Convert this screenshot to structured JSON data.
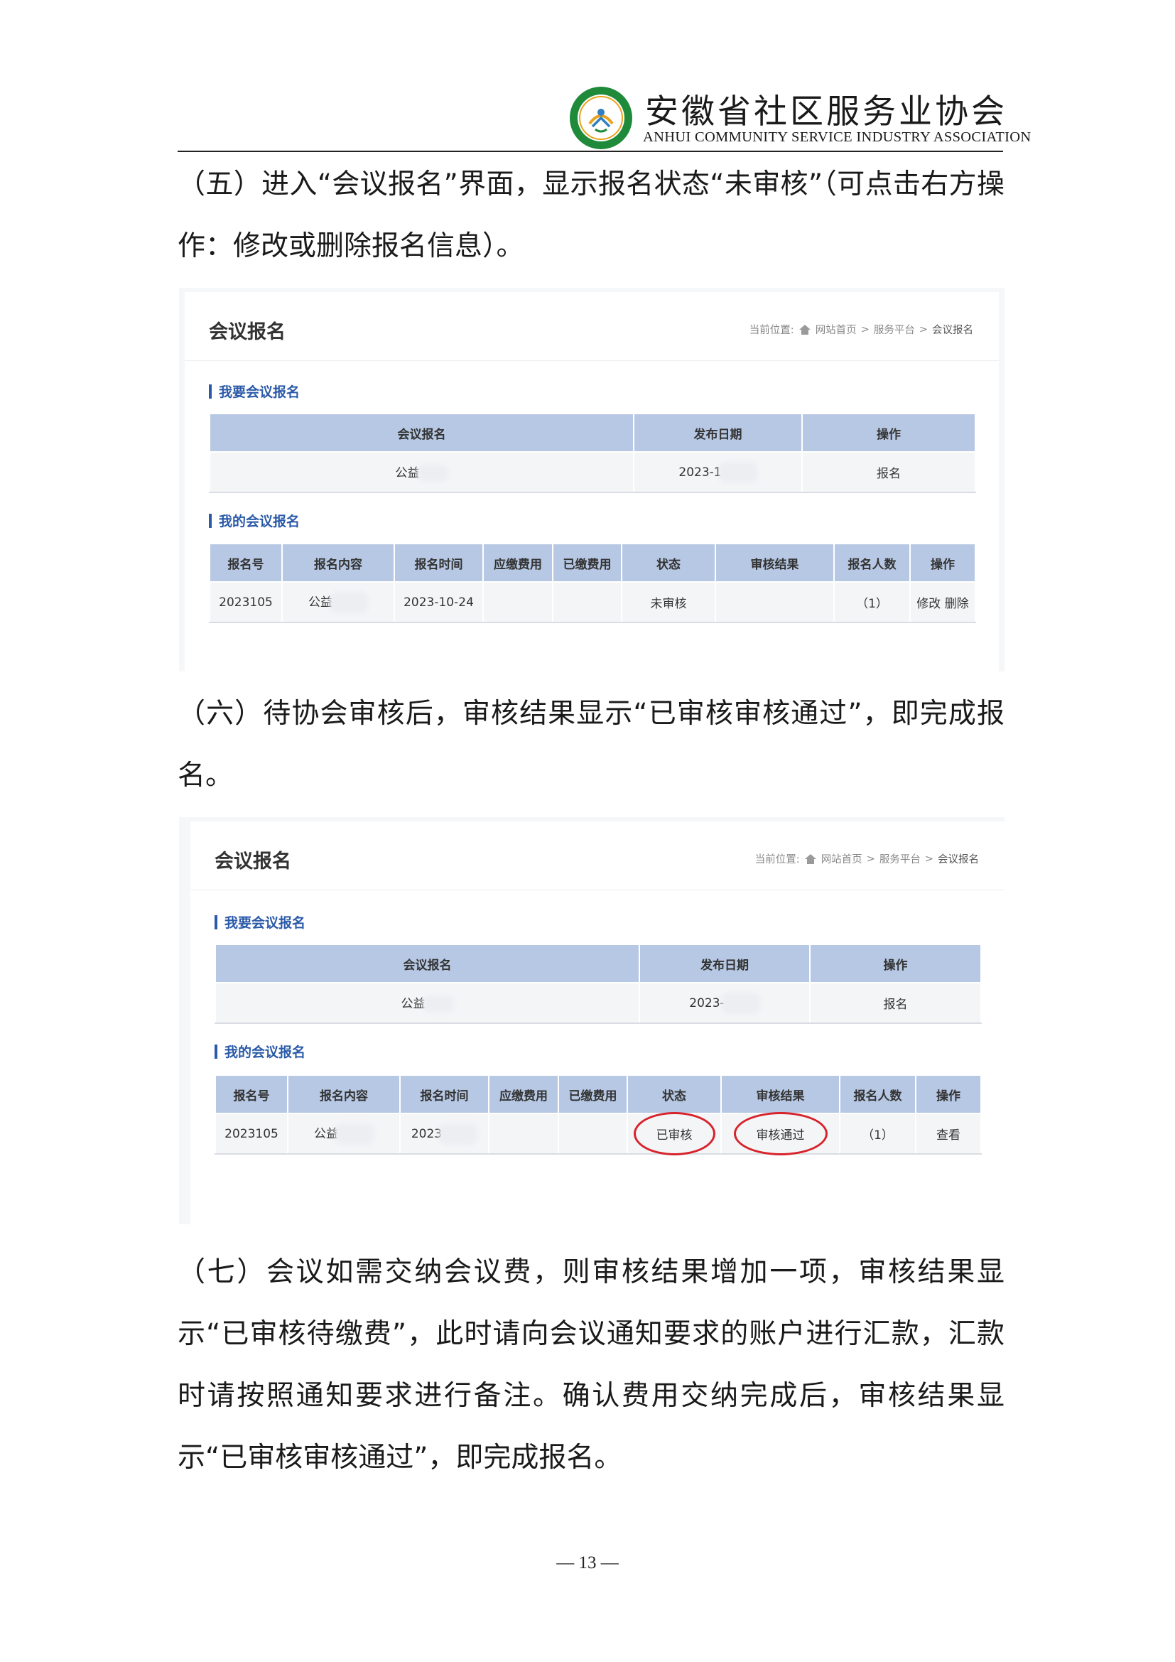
{
  "header": {
    "org_cn": "安徽省社区服务业协会",
    "org_en": "ANHUI COMMUNITY SERVICE INDUSTRY ASSOCIATION",
    "logo_text": "安徽省社区服务业协会"
  },
  "paragraphs": {
    "p5": "（五）进入“会议报名”界面，显示报名状态“未审核”（可点击右方操作：修改或删除报名信息）。",
    "p6": "（六）待协会审核后，审核结果显示“已审核审核通过”，即完成报名。",
    "p7": "（七）会议如需交纳会议费，则审核结果增加一项，审核结果显示“已审核待缴费”，此时请向会议通知要求的账户进行汇款，汇款时请按照通知要求进行备注。确认费用交纳完成后，审核结果显示“已审核审核通过”，即完成报名。"
  },
  "shot1": {
    "title": "会议报名",
    "breadcrumb": {
      "label": "当前位置:",
      "home": "网站首页",
      "sep": ">",
      "platform": "服务平台",
      "current": "会议报名"
    },
    "section1": "我要会议报名",
    "table1": {
      "headers": [
        "会议报名",
        "发布日期",
        "操作"
      ],
      "row": {
        "name": "公益",
        "date": "2023-1",
        "action": "报名"
      }
    },
    "section2": "我的会议报名",
    "table2": {
      "headers": [
        "报名号",
        "报名内容",
        "报名时间",
        "应缴费用",
        "已缴费用",
        "状态",
        "审核结果",
        "报名人数",
        "操作"
      ],
      "row": {
        "id": "2023105",
        "content": "公益",
        "time": "2023-10-24",
        "due": "",
        "paid": "",
        "status": "未审核",
        "result": "",
        "count": "（1）",
        "edit": "修改",
        "delete": "删除"
      }
    }
  },
  "shot2": {
    "title": "会议报名",
    "breadcrumb": {
      "label": "当前位置:",
      "home": "网站首页",
      "sep": ">",
      "platform": "服务平台",
      "current": "会议报名"
    },
    "section1": "我要会议报名",
    "table1": {
      "headers": [
        "会议报名",
        "发布日期",
        "操作"
      ],
      "row": {
        "name": "公益",
        "date": "2023-",
        "action": "报名"
      }
    },
    "section2": "我的会议报名",
    "table2": {
      "headers": [
        "报名号",
        "报名内容",
        "报名时间",
        "应缴费用",
        "已缴费用",
        "状态",
        "审核结果",
        "报名人数",
        "操作"
      ],
      "row": {
        "id": "2023105",
        "content": "公益",
        "time": "2023",
        "due": "",
        "paid": "",
        "status": "已审核",
        "result": "审核通过",
        "count": "（1）",
        "view": "查看"
      }
    }
  },
  "footer": {
    "page": "— 13 —"
  },
  "colors": {
    "accent_blue": "#2b5aa8",
    "table_header": "#b7c8e4",
    "circle_red": "#d7232b",
    "logo_green": "#1f8a3a"
  }
}
